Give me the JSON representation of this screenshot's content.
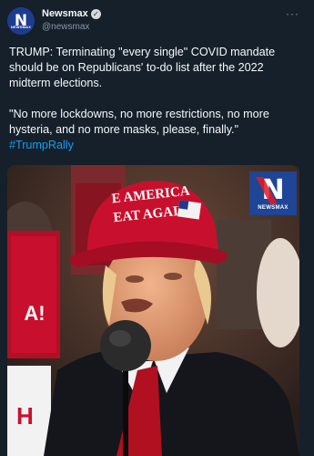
{
  "account": {
    "display_name": "Newsmax",
    "handle": "@newsmax",
    "avatar_text": "N",
    "avatar_tag": "NEWSMAX"
  },
  "tweet": {
    "paragraph1": "TRUMP: Terminating \"every single\" COVID mandate should be on Republicans' to-do list after the 2022 midterm elections.",
    "paragraph2": "\"No more lockdowns, no more restrictions, no more hysteria, and no more masks, please, finally.\" ",
    "hashtag": "#TrumpRally"
  },
  "media": {
    "hat_text_line1": "E AMERICA",
    "hat_text_line2": "EAT AGAIN",
    "sign_text_1": "A!",
    "sign_text_2": "H",
    "logo_letter": "N",
    "logo_word": "NEWSMAX"
  },
  "colors": {
    "background": "#15202b",
    "hashtag": "#1d9bf0",
    "secondary_text": "#8b98a5",
    "brand_blue": "#1e4596",
    "hat_red": "#c8102e"
  }
}
